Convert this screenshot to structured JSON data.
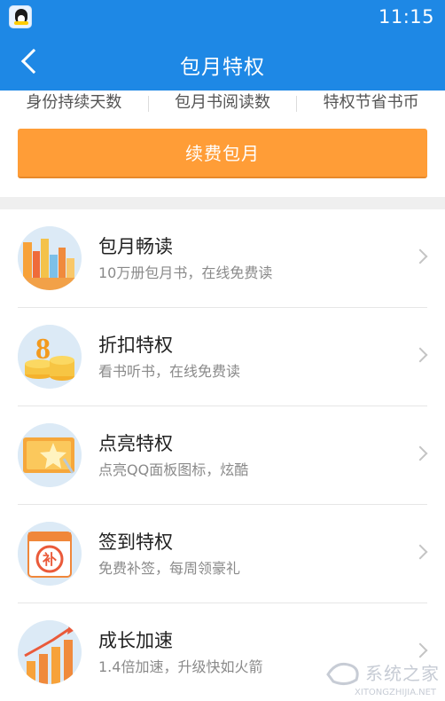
{
  "status_bar": {
    "time": "11:15"
  },
  "nav": {
    "title": "包月特权"
  },
  "stats": {
    "labels": [
      "身份持续天数",
      "包月书阅读数",
      "特权节省书币"
    ]
  },
  "renew_button": {
    "label": "续费包月"
  },
  "colors": {
    "primary_blue": "#1e88e5",
    "accent_orange": "#ff9d37"
  },
  "privileges": [
    {
      "title": "包月畅读",
      "desc": "10万册包月书，在线免费读",
      "icon": "books-icon"
    },
    {
      "title": "折扣特权",
      "desc": "看书听书，在线免费读",
      "icon": "discount-coins-icon"
    },
    {
      "title": "点亮特权",
      "desc": "点亮QQ面板图标，炫酷",
      "icon": "star-card-icon"
    },
    {
      "title": "签到特权",
      "desc": "免费补签，每周领豪礼",
      "icon": "calendar-icon"
    },
    {
      "title": "成长加速",
      "desc": "1.4倍加速，升级快如火箭",
      "icon": "growth-chart-icon"
    }
  ],
  "watermark": {
    "text": "系统之家",
    "url": "XITONGZHIJIA.NET"
  }
}
